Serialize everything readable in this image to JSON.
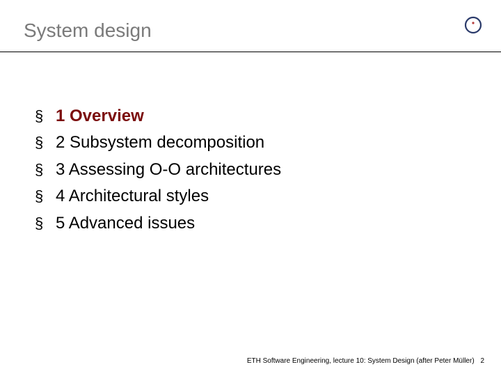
{
  "header": {
    "title": "System design"
  },
  "logo": {
    "ring_color": "#2a3a6a",
    "dot_color": "#b43b3b"
  },
  "items": [
    {
      "bullet": "§",
      "label": "1 Overview",
      "active": true
    },
    {
      "bullet": "§",
      "label": "2 Subsystem decomposition",
      "active": false
    },
    {
      "bullet": "§",
      "label": "3 Assessing O-O architectures",
      "active": false
    },
    {
      "bullet": "§",
      "label": "4 Architectural styles",
      "active": false
    },
    {
      "bullet": "§",
      "label": "5 Advanced issues",
      "active": false
    }
  ],
  "footer": {
    "text": "ETH Software Engineering, lecture 10: System Design (after Peter Müller)",
    "page": "2"
  }
}
